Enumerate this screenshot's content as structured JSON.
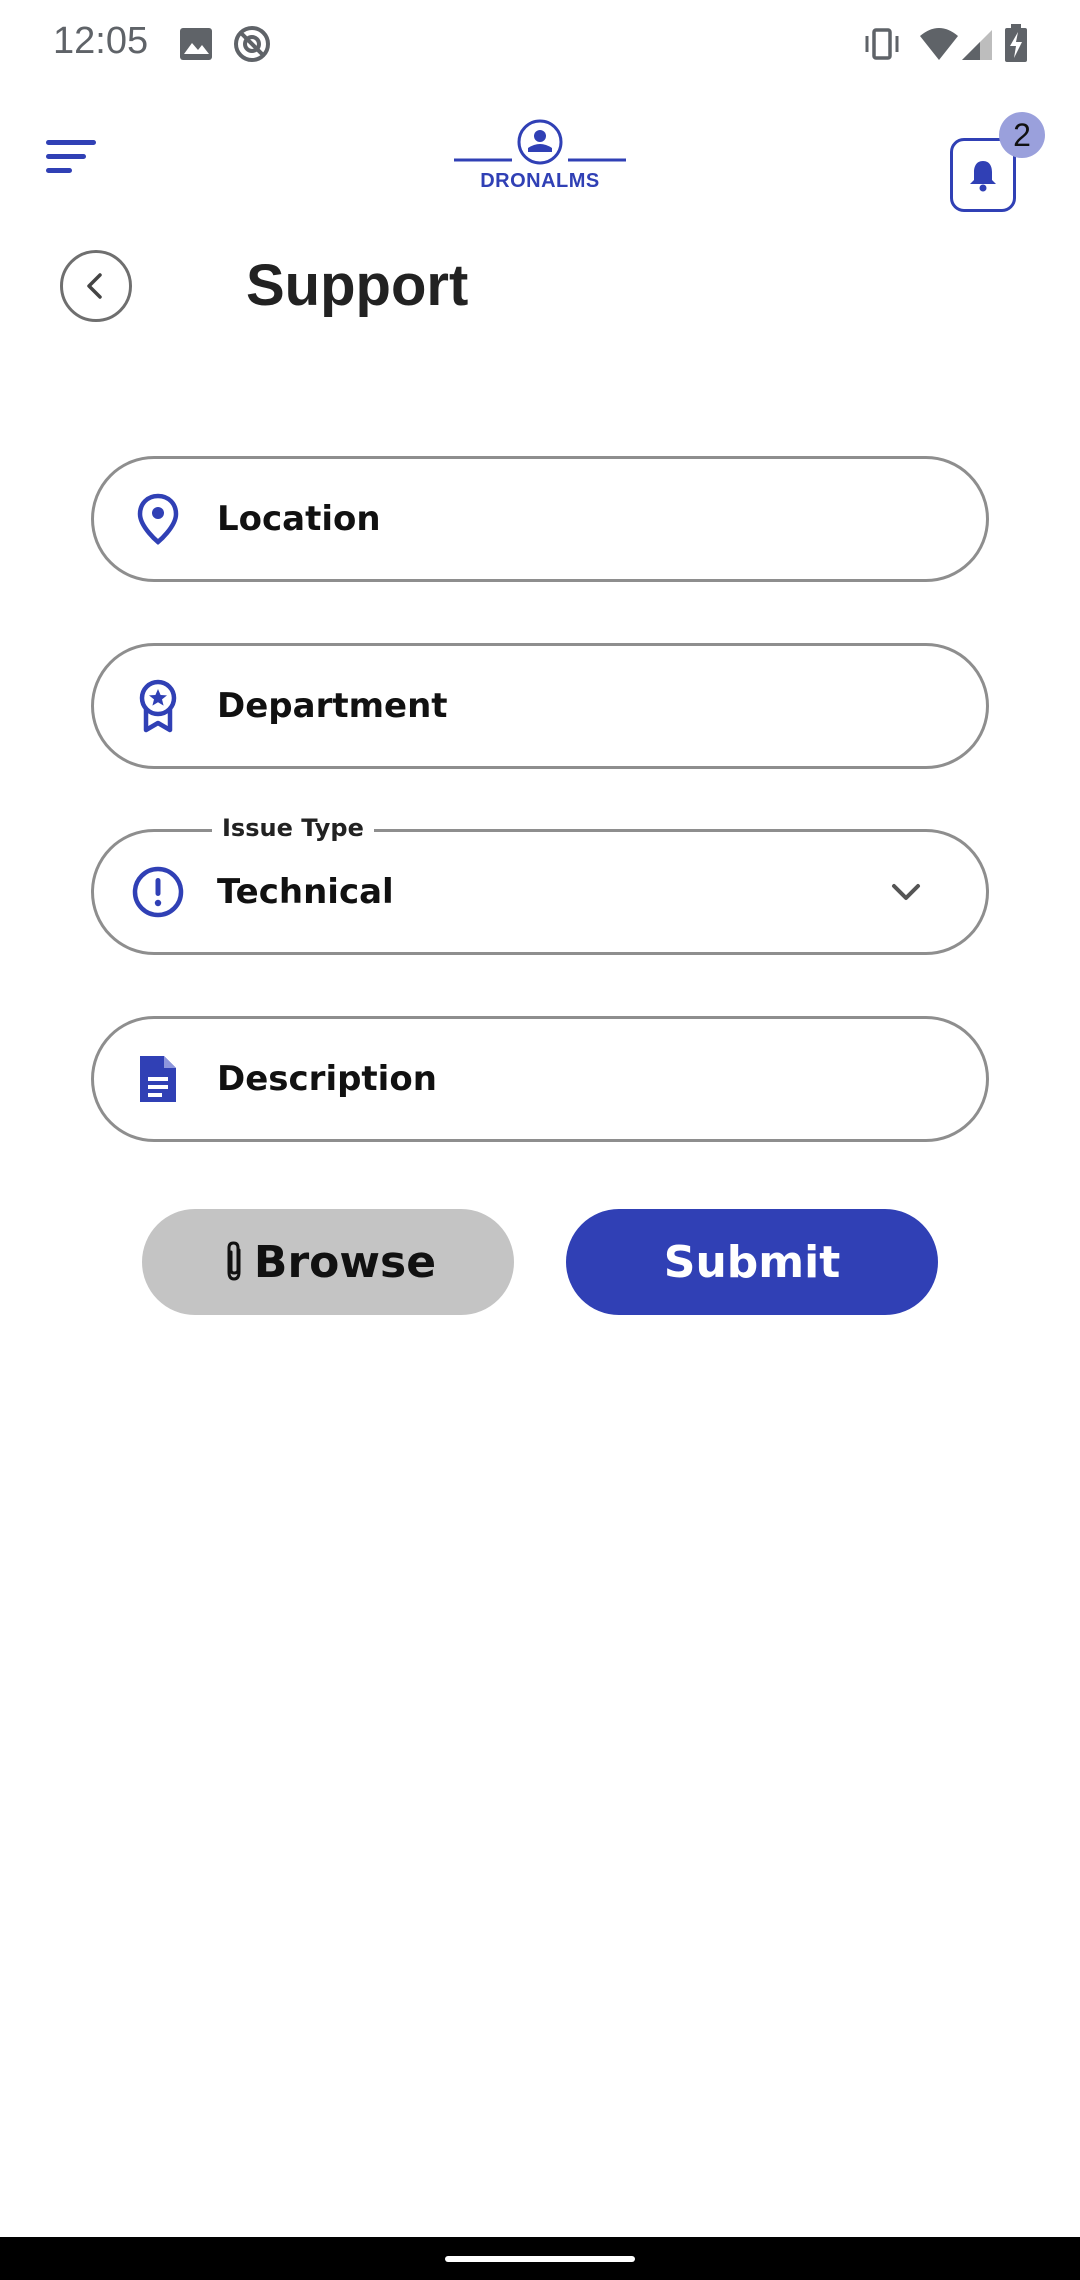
{
  "status_bar": {
    "time": "12:05"
  },
  "header": {
    "logo_text": "DRONALMS",
    "notification_count": "2"
  },
  "page": {
    "title": "Support"
  },
  "form": {
    "location": {
      "label": "Location",
      "icon": "location-pin-icon"
    },
    "department": {
      "label": "Department",
      "icon": "award-ribbon-icon"
    },
    "issue_type": {
      "legend": "Issue Type",
      "value": "Technical",
      "icon": "alert-circle-icon"
    },
    "description": {
      "label": "Description",
      "icon": "document-icon"
    }
  },
  "actions": {
    "browse_label": "Browse",
    "submit_label": "Submit"
  },
  "colors": {
    "accent": "#3040b5",
    "badge": "#9aa0dc",
    "browse_bg": "#c4c4c4"
  }
}
